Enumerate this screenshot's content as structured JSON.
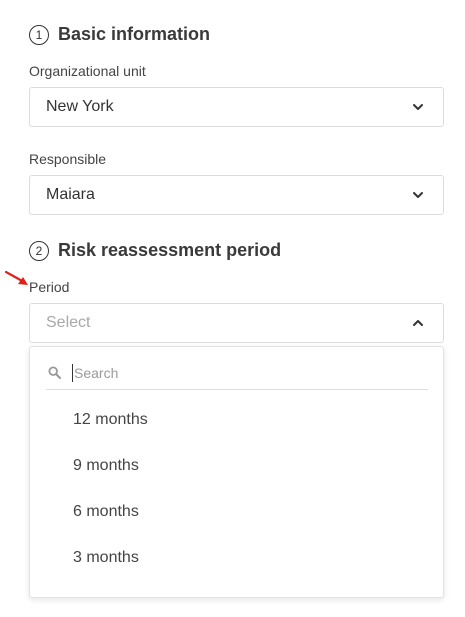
{
  "section1": {
    "step": "1",
    "title": "Basic information"
  },
  "org_unit": {
    "label": "Organizational unit",
    "value": "New York"
  },
  "responsible": {
    "label": "Responsible",
    "value": "Maiara"
  },
  "section2": {
    "step": "2",
    "title": "Risk reassessment period"
  },
  "period": {
    "label": "Period",
    "placeholder": "Select",
    "search_placeholder": "Search",
    "options": [
      "12 months",
      "9 months",
      "6 months",
      "3 months"
    ]
  },
  "colors": {
    "arrow": "#e0201b",
    "border": "#dcdcdc",
    "text": "#333333"
  },
  "icons": {
    "chevron": "chevron-down-icon",
    "chevron_open": "chevron-up-icon",
    "search": "search-icon"
  }
}
